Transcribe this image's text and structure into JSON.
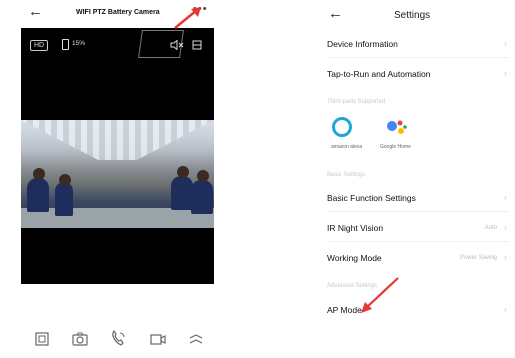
{
  "camera_screen": {
    "title": "WIFI PTZ Battery Camera",
    "back_glyph": "←",
    "more_glyph": "•••",
    "quality_badge": "HD",
    "battery_percent": "15%",
    "toolbar_icons": [
      "screenshot-icon",
      "camera-snapshot-icon",
      "talk-icon",
      "record-icon",
      "more-controls-icon"
    ]
  },
  "settings_screen": {
    "title": "Settings",
    "back_glyph": "←",
    "rows": [
      {
        "label": "Device Information",
        "value": ""
      },
      {
        "label": "Tap-to-Run and Automation",
        "value": ""
      },
      {
        "label": "Basic Function Settings",
        "value": ""
      },
      {
        "label": "IR Night Vision",
        "value": "Auto"
      },
      {
        "label": "Working Mode",
        "value": "Power Saving"
      },
      {
        "label": "AP Mode",
        "value": ""
      }
    ],
    "sections": {
      "third_party": "Third-party Supported",
      "basic": "Basic Settings",
      "advanced": "Advanced Settings"
    },
    "assistants": [
      {
        "name": "amazon alexa"
      },
      {
        "name": "Google Home"
      }
    ]
  },
  "colors": {
    "annotation_arrow": "#e53935",
    "alexa": "#1fa6d9",
    "text": "#111111",
    "muted": "#c9c9c9"
  }
}
